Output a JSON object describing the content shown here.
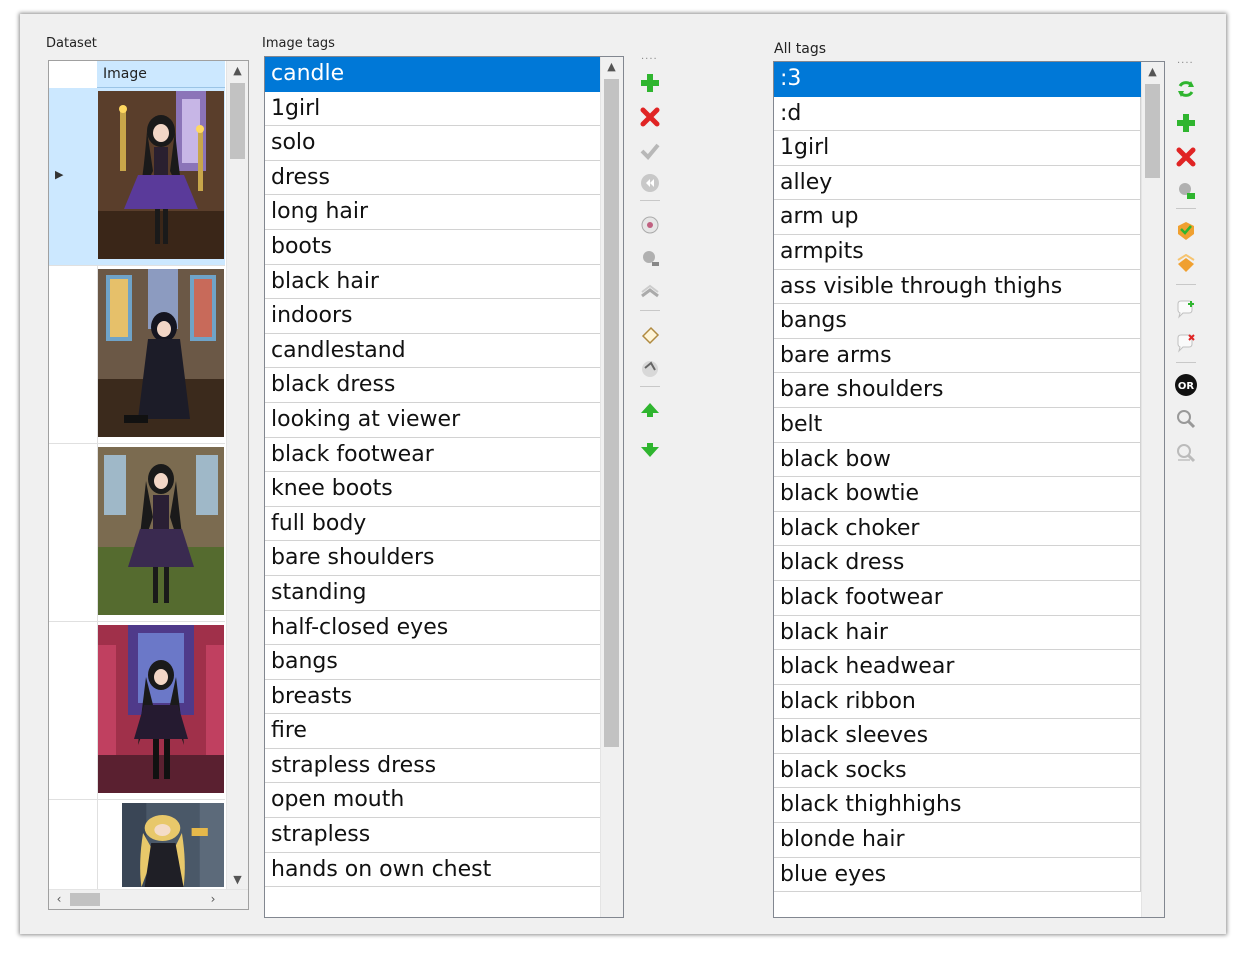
{
  "labels": {
    "dataset": "Dataset",
    "image_tags": "Image tags",
    "all_tags": "All tags"
  },
  "dataset": {
    "column_header": "Image",
    "rows": [
      {
        "selected": true,
        "scene": "church-candles"
      },
      {
        "selected": false,
        "scene": "church-kneeling"
      },
      {
        "selected": false,
        "scene": "church-standing"
      },
      {
        "selected": false,
        "scene": "church-pink"
      },
      {
        "selected": false,
        "scene": "city-blonde"
      }
    ]
  },
  "image_tags": [
    "candle",
    "1girl",
    "solo",
    "dress",
    "long hair",
    "boots",
    "black hair",
    "indoors",
    "candlestand",
    "black dress",
    "looking at viewer",
    "black footwear",
    "knee boots",
    "full body",
    "bare shoulders",
    "standing",
    "half-closed eyes",
    "bangs",
    "breasts",
    "fire",
    "strapless dress",
    "open mouth",
    "strapless",
    "hands on own chest"
  ],
  "image_tags_selected": 0,
  "all_tags": [
    ":3",
    ":d",
    "1girl",
    "alley",
    "arm up",
    "armpits",
    "ass visible through thighs",
    "bangs",
    "bare arms",
    "bare shoulders",
    "belt",
    "black bow",
    "black bowtie",
    "black choker",
    "black dress",
    "black footwear",
    "black hair",
    "black headwear",
    "black ribbon",
    "black sleeves",
    "black socks",
    "black thighhighs",
    "blonde hair",
    "blue eyes"
  ],
  "all_tags_selected": 0,
  "middle_toolbar_icons": [
    "add-tag-icon",
    "remove-tag-icon",
    "apply-check-icon",
    "undo-icon",
    "replace-tag-icon",
    "search-person-icon",
    "copy-tags-icon",
    "edit-tag-icon",
    "paste-tags-icon",
    "move-up-icon",
    "move-down-icon"
  ],
  "right_toolbar_icons": [
    "refresh-icon",
    "add-tag-icon",
    "remove-tag-icon",
    "find-replace-icon",
    "add-to-selected-icon",
    "add-to-all-icon",
    "add-comment-icon",
    "remove-comment-icon",
    "or-filter-icon",
    "zoom-in-icon",
    "zoom-out-icon"
  ],
  "or_label": "OR",
  "colors": {
    "selection": "#0078d7",
    "row_selected": "#cce8ff",
    "add_green": "#2fb52f",
    "remove_red": "#e02424"
  }
}
